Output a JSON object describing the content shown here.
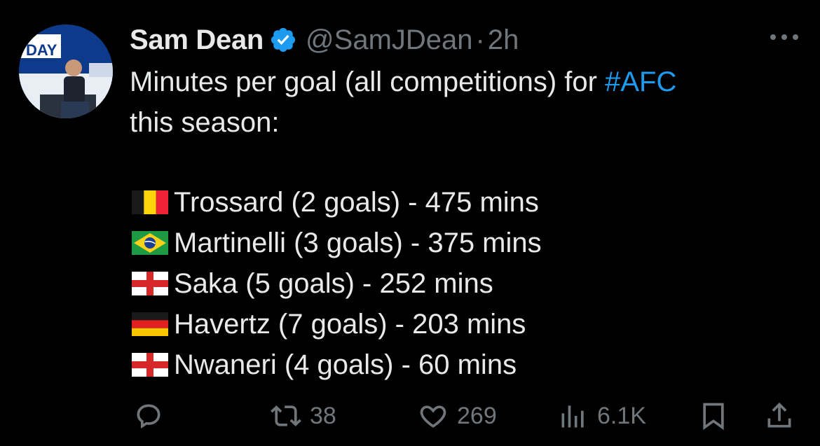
{
  "tweet": {
    "author_name": "Sam Dean",
    "handle": "@SamJDean",
    "separator": "·",
    "time": "2h",
    "text_line1": "Minutes per goal (all competitions) for ",
    "hashtag": "#AFC",
    "text_line2": "this season:",
    "avatar_banner_text": "DAY",
    "players": [
      {
        "flag": "belgium-flag-icon",
        "text": "Trossard (2 goals) - 475 mins"
      },
      {
        "flag": "brazil-flag-icon",
        "text": "Martinelli (3 goals) - 375 mins"
      },
      {
        "flag": "england-flag-icon",
        "text": "Saka (5 goals) - 252 mins"
      },
      {
        "flag": "germany-flag-icon",
        "text": "Havertz (7 goals) - 203 mins"
      },
      {
        "flag": "england-flag-icon",
        "text": "Nwaneri (4 goals) - 60 mins"
      }
    ]
  },
  "actions": {
    "reposts": "38",
    "likes": "269",
    "views": "6.1K"
  },
  "colors": {
    "background": "#000000",
    "text": "#e7e9ea",
    "muted": "#71767b",
    "accent": "#1d9bf0"
  }
}
